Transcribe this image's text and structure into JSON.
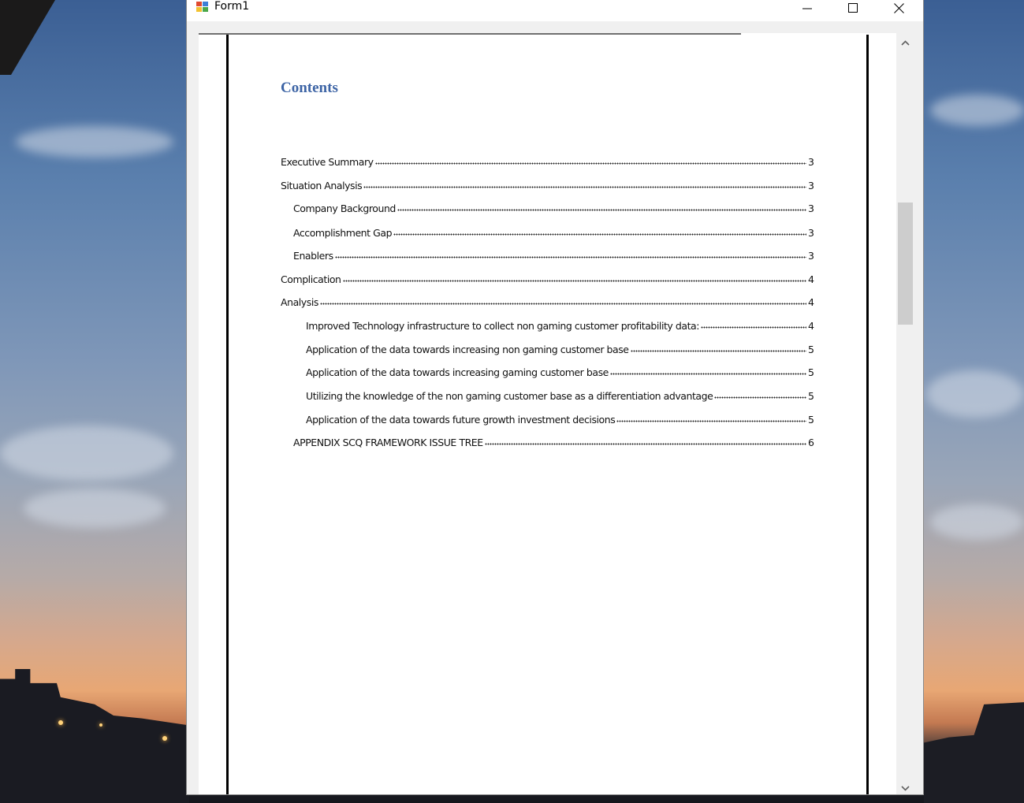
{
  "window": {
    "title": "Form1"
  },
  "document": {
    "heading": "Contents",
    "toc": [
      {
        "label": "Executive Summary",
        "page": "3",
        "level": 1
      },
      {
        "label": "Situation Analysis",
        "page": "3",
        "level": 1
      },
      {
        "label": "Company Background",
        "page": "3",
        "level": 2
      },
      {
        "label": "Accomplishment Gap",
        "page": "3",
        "level": 2
      },
      {
        "label": "Enablers",
        "page": "3",
        "level": 2
      },
      {
        "label": "Complication",
        "page": "4",
        "level": 1
      },
      {
        "label": "Analysis",
        "page": "4",
        "level": 1
      },
      {
        "label": "Improved Technology infrastructure to collect non gaming customer profitability data:",
        "page": "4",
        "level": 3
      },
      {
        "label": "Application of the data towards increasing non gaming customer base",
        "page": "5",
        "level": 3
      },
      {
        "label": "Application of the data towards increasing gaming customer base",
        "page": "5",
        "level": 3
      },
      {
        "label": "Utilizing the knowledge of the non gaming customer base as a differentiation advantage",
        "page": "5",
        "level": 3
      },
      {
        "label": "Application of the data towards future growth investment decisions",
        "page": "5",
        "level": 3
      },
      {
        "label": "APPENDIX SCQ FRAMEWORK ISSUE TREE",
        "page": "6",
        "level": 2
      }
    ]
  },
  "icons": {
    "app": "form-app-icon",
    "minimize": "minimize-icon",
    "maximize": "maximize-icon",
    "close": "close-icon",
    "scroll_up": "chevron-up-icon",
    "scroll_down": "chevron-down-icon"
  },
  "colors": {
    "heading": "#3d64a5",
    "scroll_thumb": "#cdcdcd",
    "client_bg": "#f0f0f0"
  }
}
